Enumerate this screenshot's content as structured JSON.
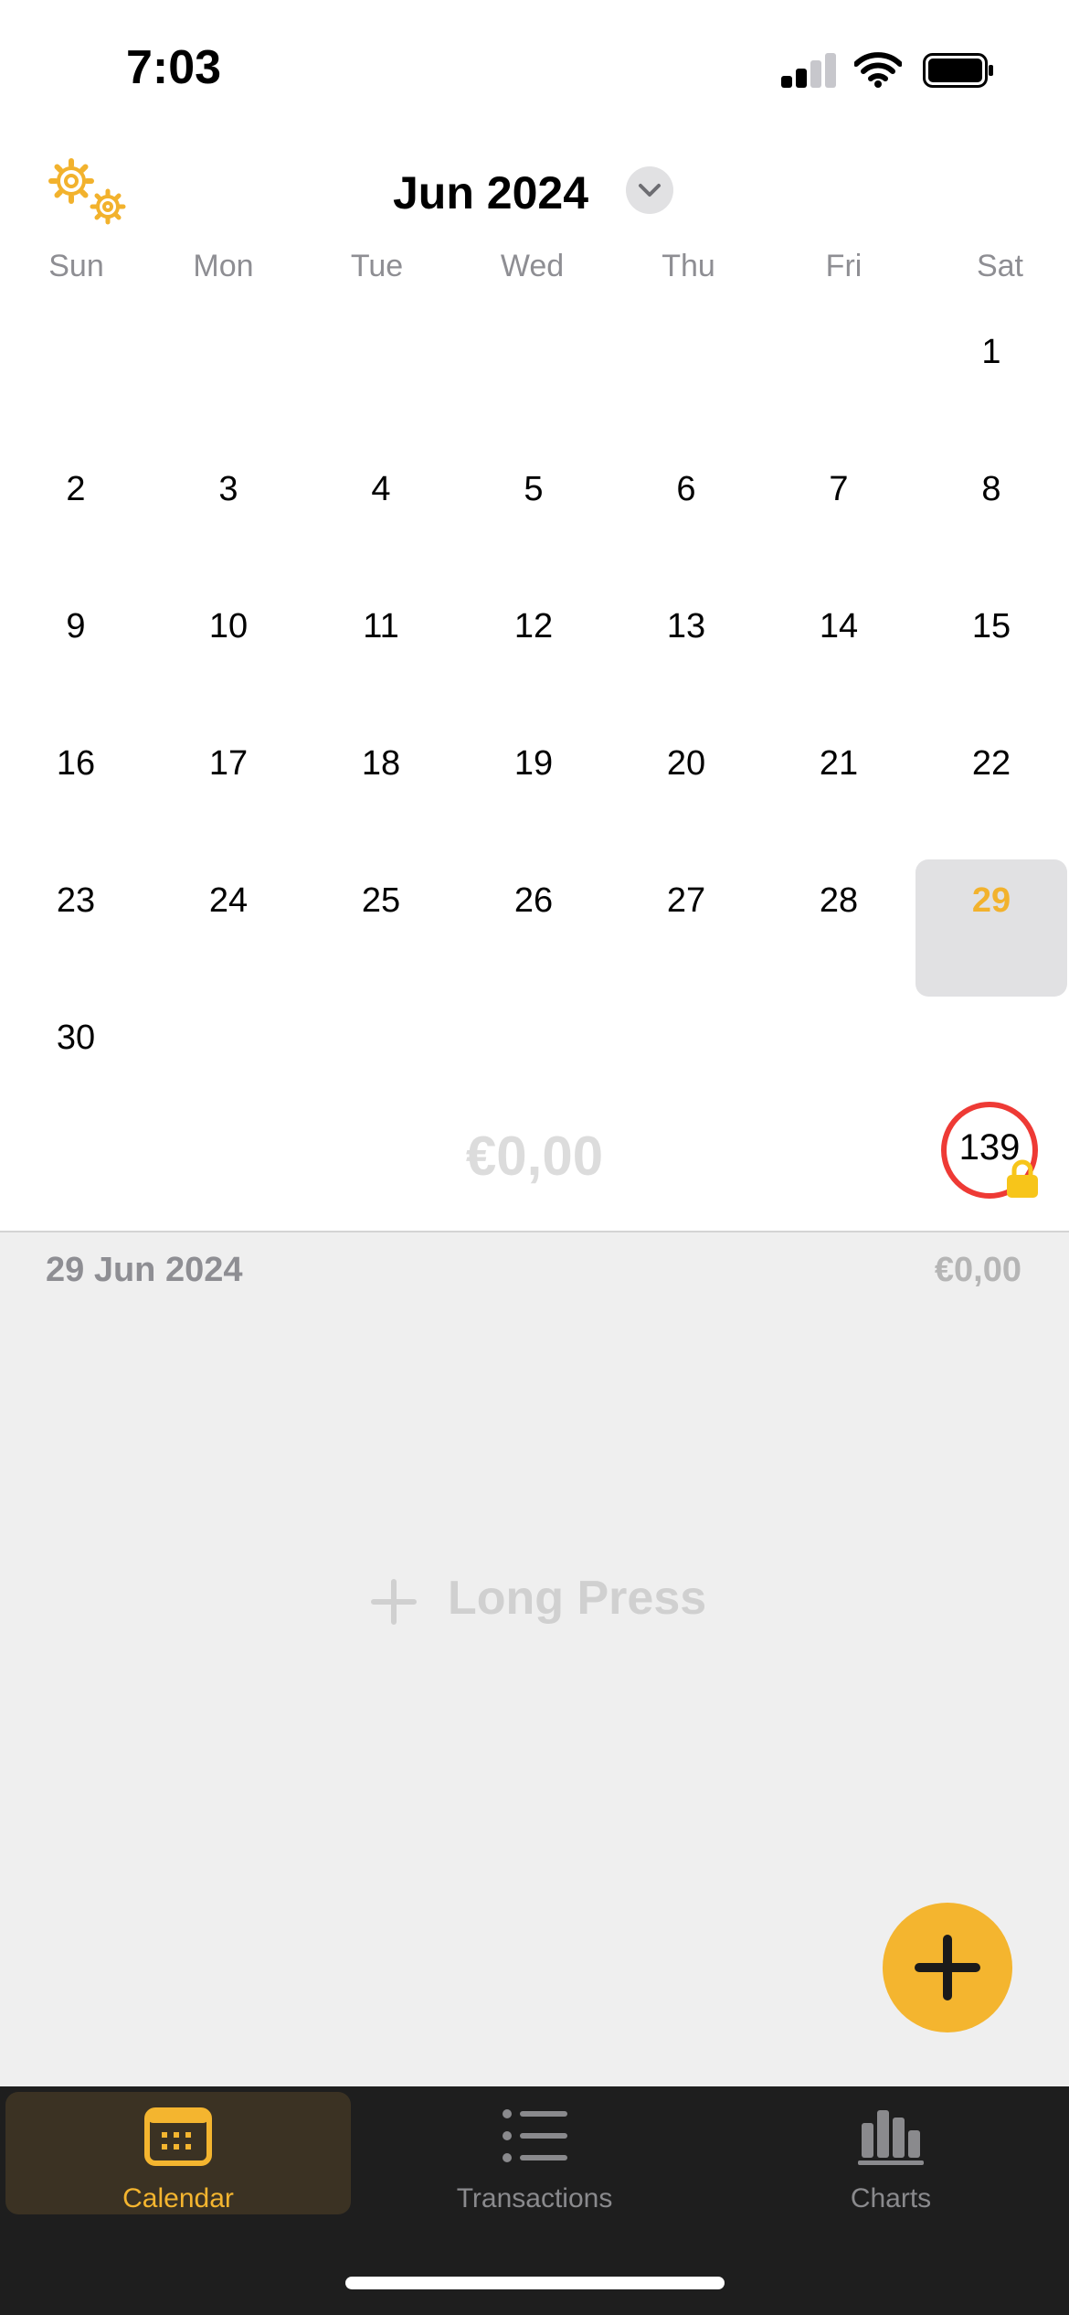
{
  "status_bar": {
    "time": "7:03"
  },
  "header": {
    "month_title": "Jun 2024"
  },
  "weekdays": [
    "Sun",
    "Mon",
    "Tue",
    "Wed",
    "Thu",
    "Fri",
    "Sat"
  ],
  "calendar": {
    "days": [
      "1",
      "2",
      "3",
      "4",
      "5",
      "6",
      "7",
      "8",
      "9",
      "10",
      "11",
      "12",
      "13",
      "14",
      "15",
      "16",
      "17",
      "18",
      "19",
      "20",
      "21",
      "22",
      "23",
      "24",
      "25",
      "26",
      "27",
      "28",
      "29",
      "30"
    ],
    "selected_day": "29"
  },
  "summary": {
    "month_total": "€0,00",
    "counter": "139"
  },
  "detail": {
    "date": "29 Jun 2024",
    "amount": "€0,00",
    "long_press_label": "Long Press"
  },
  "tabs": [
    {
      "label": "Calendar",
      "icon": "calendar-icon",
      "active": true
    },
    {
      "label": "Transactions",
      "icon": "list-icon",
      "active": false
    },
    {
      "label": "Charts",
      "icon": "bar-chart-icon",
      "active": false
    }
  ],
  "colors": {
    "accent": "#F4B52F",
    "counter_ring": "#EE3A35",
    "tabbar_bg": "#1E1E1E"
  }
}
